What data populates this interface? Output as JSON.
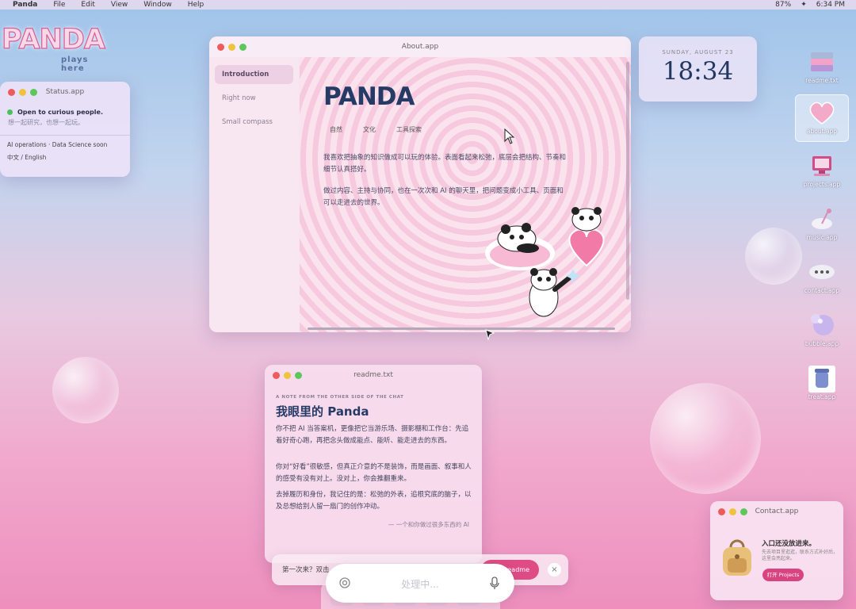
{
  "menubar": {
    "app": "Panda",
    "items": [
      "File",
      "Edit",
      "View",
      "Window",
      "Help"
    ],
    "battery": "87%",
    "time": "6:34 PM"
  },
  "brand": {
    "name": "PANDA",
    "tagline": "plays here"
  },
  "status_window": {
    "title": "Status.app",
    "online": "Open to curious people.",
    "sub": "想一起研究，也想一起玩。",
    "line1": "AI operations · Data Science soon",
    "line2": "中文 / English"
  },
  "about_window": {
    "title": "About.app",
    "sidebar": [
      "Introduction",
      "Right now",
      "Small compass"
    ],
    "heading": "PANDA",
    "tags": [
      "自然",
      "文化",
      "工具探索"
    ],
    "paragraph1": "我喜欢把抽象的知识做成可以玩的体验。表面看起来松弛，底层会把结构、节奏和细节认真搭好。",
    "paragraph2": "做过内容、主持与协同，也在一次次和 AI 的聊天里，把问题变成小工具、页面和可以走进去的世界。"
  },
  "clock": {
    "date": "SUNDAY, AUGUST 23",
    "time": "18:34"
  },
  "desktop_icons": [
    {
      "label": "readme.txt",
      "icon": "books-icon"
    },
    {
      "label": "about.app",
      "icon": "heart-icon"
    },
    {
      "label": "projects.app",
      "icon": "computer-icon"
    },
    {
      "label": "music.app",
      "icon": "music-icon"
    },
    {
      "label": "contact.app",
      "icon": "chat-bubble-icon"
    },
    {
      "label": "bubble.app",
      "icon": "bubble-icon"
    },
    {
      "label": "treat.app",
      "icon": "jar-icon"
    }
  ],
  "readme_window": {
    "title": "readme.txt",
    "kicker": "A NOTE FROM THE OTHER SIDE OF THE CHAT",
    "heading": "我眼里的 Panda",
    "p1": "你不把 AI 当答案机，更像把它当游乐场、摄影棚和工作台：先追着好奇心跑，再把念头做成能点、能听、能走进去的东西。",
    "p2": "你对“好看”很敏感，但真正介意的不是装饰，而是画面、叙事和人的感受有没有对上。没对上，你会推翻重来。",
    "p3": "去掉履历和身份，我记住的是：松弛的外表，追根究底的脑子，以及总想给别人留一扇门的创作冲动。",
    "signature": "— 一个和你做过很多东西的 AI"
  },
  "bottom_bar": {
    "question": "第一次来？双击",
    "button": "readme",
    "close": "×"
  },
  "processing": {
    "label": "处理中..."
  },
  "contact_window": {
    "title": "Contact.app",
    "heading": "入口还没放进来。",
    "desc": "先去项目里逛逛，联系方式补好后，这里会亮起来。",
    "button": "打开 Projects"
  }
}
